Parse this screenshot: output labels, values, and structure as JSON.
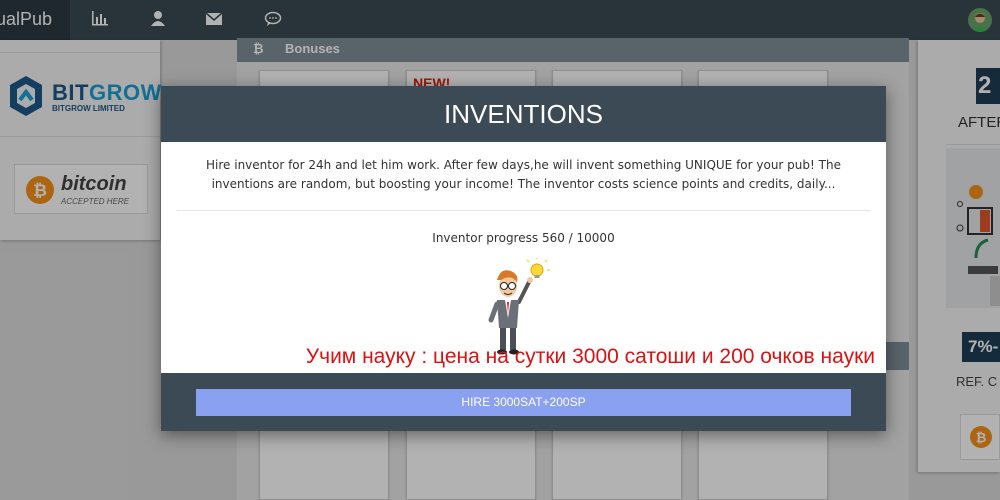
{
  "app": {
    "brand_partial": "ualPub"
  },
  "nav": {
    "icons": [
      "bar-chart-icon",
      "user-icon",
      "envelope-icon",
      "chat-icon"
    ]
  },
  "left_panel": {
    "bitgrow": {
      "name_a": "BIT",
      "name_b": "GROW",
      "sub": "BITGROW LIMITED"
    },
    "bitcoin_badge": {
      "word": "bitcoin",
      "sub": "ACCEPTED HERE"
    }
  },
  "bonuses": {
    "header": "Bonuses",
    "new_badge": "NEW!"
  },
  "right_panel": {
    "big_num": "2",
    "after": "AFTER",
    "percent": "7%-",
    "ref": "REF. C"
  },
  "modal": {
    "title": "INVENTIONS",
    "description": "Hire inventor for 24h and let him work. After few days,he will invent something UNIQUE for your pub! The inventions are random, but boosting your income! The inventor costs science points and credits, daily...",
    "progress_label": "Inventor progress",
    "progress_value": "560 / 10000",
    "progress_fraction": 0.056,
    "note": "Учим науку : цена на сутки 3000 сатоши и 200 очков науки",
    "hire_button": "HIRE 3000SAT+200SP"
  },
  "colors": {
    "topbar": "#3a4a54",
    "modal_header": "#3b4a54",
    "hire_button": "#8aa0f0",
    "note_red": "#dd1111"
  }
}
